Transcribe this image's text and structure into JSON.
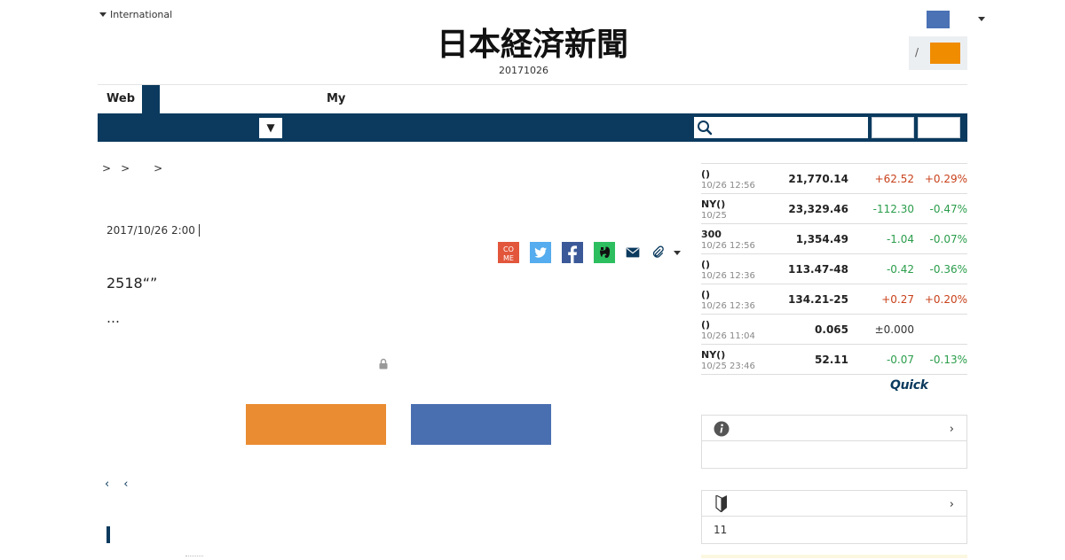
{
  "header": {
    "edition_label": "International",
    "logo_text": "日本経済新聞",
    "edition_date": "20171026",
    "login_separator": "/"
  },
  "tabs": {
    "web_label": "Web",
    "my_label": "My"
  },
  "nav": {
    "select_value": "▼",
    "search_placeholder": ""
  },
  "article": {
    "breadcrumbs": [
      ">",
      ">",
      ">"
    ],
    "published": "2017/10/26 2:00",
    "headline": "2518“”",
    "lead": "…",
    "share_icons": [
      "comment-icon",
      "twitter-icon",
      "facebook-icon",
      "evernote-icon",
      "mail-icon",
      "clip-icon"
    ],
    "pager": [
      "‹",
      "‹"
    ]
  },
  "markets": [
    {
      "name": "()",
      "time": "10/26 12:56",
      "value": "21,770.14",
      "change": "+62.52",
      "pct": "+0.29%",
      "dir": "up"
    },
    {
      "name": "NY()",
      "time": "10/25",
      "value": "23,329.46",
      "change": "-112.30",
      "pct": "-0.47%",
      "dir": "down"
    },
    {
      "name": "300",
      "time": "10/26 12:56",
      "value": "1,354.49",
      "change": "-1.04",
      "pct": "-0.07%",
      "dir": "down"
    },
    {
      "name": "()",
      "time": "10/26 12:36",
      "value": "113.47-48",
      "change": "-0.42",
      "pct": "-0.36%",
      "dir": "down"
    },
    {
      "name": "()",
      "time": "10/26 12:36",
      "value": "134.21-25",
      "change": "+0.27",
      "pct": "+0.20%",
      "dir": "up"
    },
    {
      "name": "()",
      "time": "10/26 11:04",
      "value": "0.065",
      "change": "±0.000",
      "pct": "",
      "dir": "flat"
    },
    {
      "name": "NY()",
      "time": "10/25 23:46",
      "value": "52.11",
      "change": "-0.07",
      "pct": "-0.13%",
      "dir": "down"
    }
  ],
  "quick_label": "Quick",
  "sidebox2": {
    "text": "11"
  },
  "colors": {
    "navy": "#0b3a5e",
    "up": "#c8411b",
    "down": "#2a9d4b",
    "login_orange": "#f08c00",
    "btn_orange": "#ea8c32",
    "btn_blue": "#4a6fb0"
  }
}
